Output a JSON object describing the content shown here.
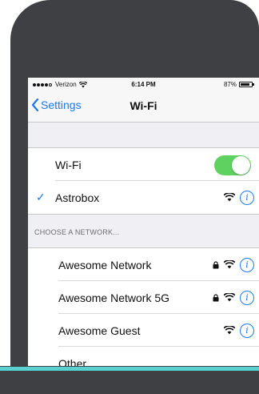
{
  "status_bar": {
    "carrier": "Verizon",
    "time": "6:14 PM",
    "battery_percent": "87%",
    "battery_level": 0.87
  },
  "nav": {
    "back_label": "Settings",
    "title": "Wi-Fi"
  },
  "wifi": {
    "label": "Wi-Fi",
    "enabled": true,
    "connected_network": "Astrobox"
  },
  "networks_section": {
    "header": "CHOOSE A NETWORK...",
    "items": [
      {
        "name": "Awesome Network",
        "locked": true
      },
      {
        "name": "Awesome Network 5G",
        "locked": true
      },
      {
        "name": "Awesome Guest",
        "locked": false
      }
    ],
    "other_label": "Other..."
  },
  "colors": {
    "accent": "#1d79f2",
    "toggle_on": "#5fd161",
    "phone_body": "#3f4043",
    "teal_strip": "#5bd1cf"
  },
  "icons": {
    "info": "info-icon",
    "wifi": "wifi-icon",
    "lock": "lock-icon",
    "check": "checkmark-icon",
    "back": "chevron-left-icon"
  }
}
